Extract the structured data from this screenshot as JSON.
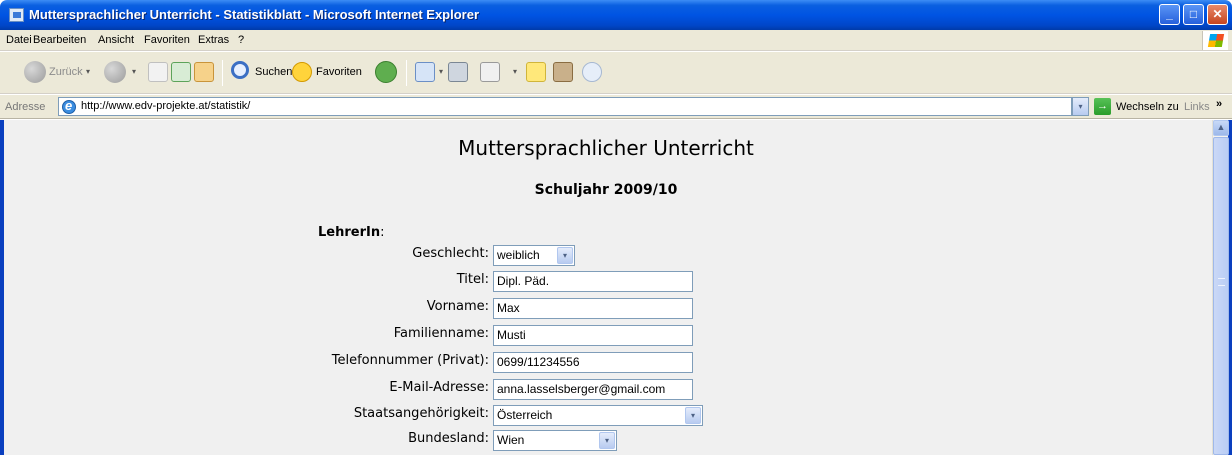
{
  "window": {
    "title": "Muttersprachlicher Unterricht - Statistikblatt - Microsoft Internet Explorer",
    "minimize": "_",
    "maximize": "□",
    "close": "✕"
  },
  "menu": [
    "Datei",
    "Bearbeiten",
    "Ansicht",
    "Favoriten",
    "Extras",
    "?"
  ],
  "toolbar": {
    "back_label": "Zurück",
    "search_label": "Suchen",
    "favorites_label": "Favoriten"
  },
  "address": {
    "label": "Adresse",
    "url": "http://www.edv-projekte.at/statistik/",
    "go_label": "Wechseln zu",
    "links_label": "Links",
    "links_more": "»"
  },
  "page": {
    "title": "Muttersprachlicher Unterricht",
    "subtitle": "Schuljahr 2009/10",
    "section_bold": "LehrerIn",
    "section_colon": ":"
  },
  "form": {
    "gender_label": "Geschlecht:",
    "gender_value": "weiblich",
    "title_label": "Titel:",
    "title_value": "Dipl. Päd.",
    "firstname_label": "Vorname:",
    "firstname_value": "Max",
    "lastname_label": "Familienname:",
    "lastname_value": "Musti",
    "phone_label": "Telefonnummer (Privat):",
    "phone_value": "0699/11234556",
    "email_label": "E-Mail-Adresse:",
    "email_value": "anna.lasselsberger@gmail.com",
    "nationality_label": "Staatsangehörigkeit:",
    "nationality_value": "Österreich",
    "state_label": "Bundesland:",
    "state_value": "Wien"
  },
  "icons": {
    "dropdown": "▾",
    "scroll_up": "▲",
    "go": "→"
  }
}
